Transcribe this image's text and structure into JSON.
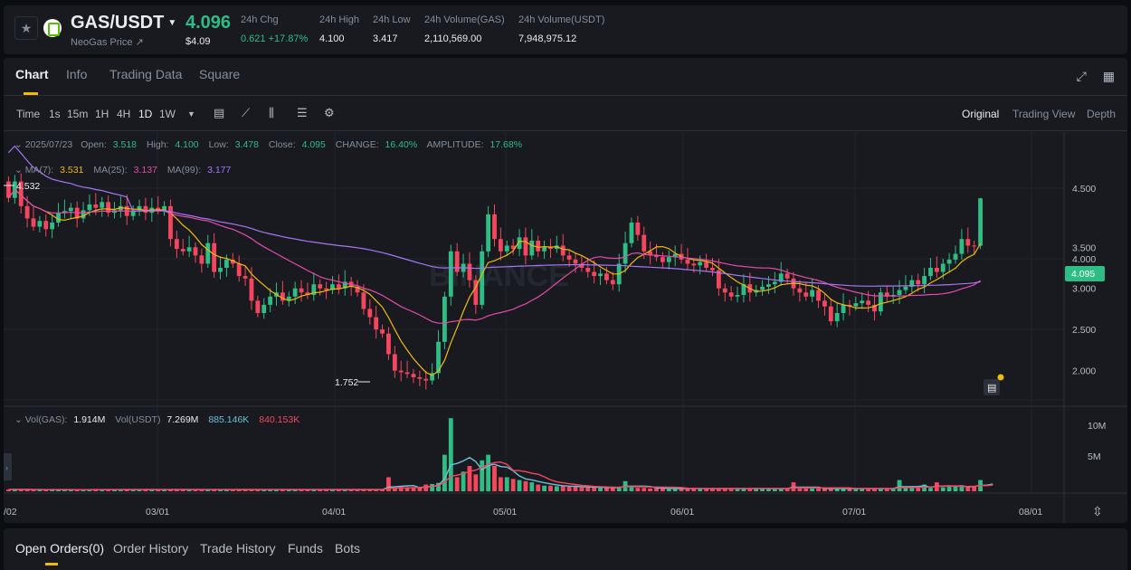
{
  "ticker": {
    "pair": "GAS/USDT",
    "sub_label": "NeoGas Price ↗",
    "last_price": "4.096",
    "last_price_usd": "$4.09",
    "stats": [
      {
        "label": "24h Chg",
        "value": "0.621 +17.87%",
        "up": true
      },
      {
        "label": "24h High",
        "value": "4.100",
        "up": false
      },
      {
        "label": "24h Low",
        "value": "3.417",
        "up": false
      },
      {
        "label": "24h Volume(GAS)",
        "value": "2,110,569.00",
        "up": false
      },
      {
        "label": "24h Volume(USDT)",
        "value": "7,948,975.12",
        "up": false
      }
    ]
  },
  "tabs": [
    "Chart",
    "Info",
    "Trading Data",
    "Square"
  ],
  "toolbar": {
    "intervals": [
      "Time",
      "1s",
      "15m",
      "1H",
      "4H",
      "1D",
      "1W"
    ],
    "active_interval": "1D",
    "views": [
      "Original",
      "Trading View",
      "Depth"
    ],
    "active_view": "Original"
  },
  "ohlc_info": {
    "date": "2025/07/23",
    "items": [
      {
        "label": "Open:",
        "value": "3.518"
      },
      {
        "label": "High:",
        "value": "4.100"
      },
      {
        "label": "Low:",
        "value": "3.478"
      },
      {
        "label": "Close:",
        "value": "4.095"
      },
      {
        "label": "CHANGE:",
        "value": "16.40%"
      },
      {
        "label": "AMPLITUDE:",
        "value": "17.68%"
      }
    ]
  },
  "ma_info": [
    {
      "label": "MA(7):",
      "value": "3.531",
      "color": "#f0b90b"
    },
    {
      "label": "MA(25):",
      "value": "3.137",
      "color": "#e44baa"
    },
    {
      "label": "MA(99):",
      "value": "3.177",
      "color": "#a875f5"
    }
  ],
  "vol_info": [
    {
      "label": "Vol(GAS):",
      "value": "1.914M",
      "color": "#eaecef"
    },
    {
      "label": "Vol(USDT)",
      "value": "7.269M",
      "color": "#eaecef"
    },
    {
      "label": "",
      "value": "885.146K",
      "color": "#6bc1d7"
    },
    {
      "label": "",
      "value": "840.153K",
      "color": "#f6465d"
    }
  ],
  "price_axis": [
    "4.500",
    "4.000",
    "3.500",
    "3.000",
    "2.500",
    "2.000"
  ],
  "volume_axis": [
    "10M",
    "5M"
  ],
  "date_axis": [
    "/02",
    "03/01",
    "04/01",
    "05/01",
    "06/01",
    "07/01",
    "08/01"
  ],
  "price_markers": {
    "current": "4.095",
    "high_label": "4.532",
    "low_label": "1.752"
  },
  "watermark": "BINANCE",
  "orders_tabs": [
    "Open Orders(0)",
    "Order History",
    "Trade History",
    "Funds",
    "Bots"
  ],
  "colors": {
    "up": "#2ebd85",
    "down": "#f6465d",
    "accent": "#f0b90b"
  },
  "chart_data": {
    "type": "candlestick",
    "interval": "1D",
    "ylim": [
      1.6,
      4.9
    ],
    "volume_ylim": [
      0,
      14000000
    ],
    "close": [
      4.1,
      4.3,
      4.0,
      3.85,
      3.75,
      3.82,
      3.72,
      3.8,
      3.92,
      3.94,
      3.98,
      3.85,
      3.95,
      4.02,
      3.98,
      4.05,
      3.92,
      3.95,
      4.0,
      3.88,
      3.95,
      4.0,
      3.92,
      3.98,
      3.95,
      4.0,
      3.6,
      3.48,
      3.45,
      3.5,
      3.4,
      3.3,
      3.55,
      3.2,
      3.25,
      3.35,
      3.3,
      3.15,
      3.12,
      2.85,
      2.7,
      2.8,
      2.9,
      2.95,
      2.85,
      2.9,
      3.0,
      2.95,
      2.92,
      3.05,
      3.0,
      2.98,
      3.05,
      3.0,
      3.08,
      3.02,
      2.95,
      2.75,
      2.65,
      2.5,
      2.45,
      2.2,
      2.0,
      1.98,
      1.96,
      1.92,
      1.9,
      1.88,
      1.97,
      2.35,
      2.9,
      3.45,
      3.2,
      3.3,
      3.1,
      2.8,
      3.45,
      3.9,
      3.6,
      3.45,
      3.52,
      3.48,
      3.62,
      3.4,
      3.58,
      3.45,
      3.5,
      3.48,
      3.52,
      3.4,
      3.35,
      3.3,
      3.25,
      3.2,
      3.15,
      3.18,
      3.1,
      3.05,
      3.3,
      3.55,
      3.8,
      3.65,
      3.45,
      3.4,
      3.38,
      3.32,
      3.38,
      3.42,
      3.35,
      3.3,
      3.28,
      3.32,
      3.25,
      3.22,
      3.0,
      2.95,
      2.9,
      2.92,
      3.05,
      2.95,
      2.98,
      3.02,
      3.05,
      3.08,
      3.18,
      3.12,
      3.0,
      2.95,
      2.9,
      2.98,
      2.85,
      2.78,
      2.6,
      2.7,
      2.8,
      2.78,
      2.82,
      2.85,
      2.8,
      2.72,
      2.95,
      2.9,
      2.92,
      2.98,
      3.02,
      3.1,
      3.05,
      3.15,
      3.25,
      3.2,
      3.3,
      3.35,
      3.42,
      3.6,
      3.52,
      3.518,
      4.095
    ],
    "volume": [
      0.3,
      0.4,
      0.3,
      0.3,
      0.25,
      0.3,
      0.3,
      0.3,
      0.3,
      0.25,
      0.3,
      0.3,
      0.3,
      0.3,
      0.3,
      0.3,
      0.3,
      0.3,
      0.3,
      0.3,
      0.3,
      0.3,
      0.3,
      0.3,
      0.3,
      0.3,
      0.3,
      0.3,
      0.3,
      0.3,
      0.3,
      0.3,
      0.3,
      0.3,
      0.3,
      0.3,
      0.3,
      0.3,
      0.3,
      0.3,
      0.3,
      0.3,
      0.3,
      0.3,
      0.3,
      0.3,
      0.3,
      0.3,
      0.3,
      0.3,
      0.3,
      0.3,
      0.3,
      0.3,
      0.3,
      0.3,
      0.3,
      0.3,
      0.3,
      0.3,
      0.3,
      2.5,
      0.6,
      0.8,
      0.6,
      0.6,
      0.6,
      1.2,
      1.3,
      1.5,
      6.5,
      13.0,
      2.5,
      3.5,
      4.5,
      3.0,
      5.5,
      6.5,
      4.5,
      2.5,
      2.5,
      2.2,
      2.0,
      1.8,
      1.6,
      1.2,
      1.0,
      1.0,
      0.9,
      0.9,
      0.8,
      0.8,
      0.7,
      0.7,
      0.7,
      0.7,
      0.6,
      0.6,
      0.8,
      1.8,
      0.8,
      0.6,
      0.6,
      0.5,
      0.5,
      0.5,
      0.5,
      0.5,
      0.5,
      0.5,
      0.5,
      0.5,
      0.5,
      0.5,
      0.5,
      0.5,
      0.5,
      0.5,
      0.5,
      0.5,
      0.5,
      0.5,
      0.5,
      0.5,
      0.5,
      0.5,
      1.6,
      0.5,
      0.5,
      0.5,
      0.5,
      0.5,
      0.5,
      0.5,
      0.5,
      0.5,
      0.5,
      0.5,
      0.5,
      0.5,
      0.5,
      0.5,
      0.5,
      2.0,
      0.6,
      0.6,
      0.6,
      1.2,
      0.6,
      1.6,
      0.7,
      0.8,
      0.9,
      0.8,
      0.8,
      0.9,
      2.0,
      0.9,
      1.914
    ]
  }
}
